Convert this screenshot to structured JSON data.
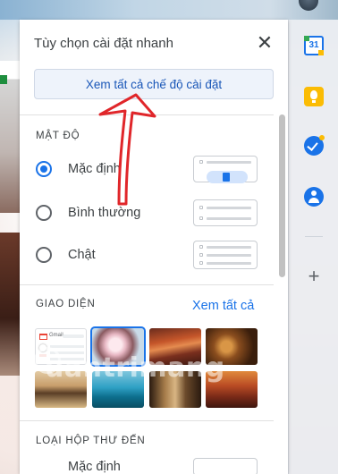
{
  "quick_settings": {
    "title": "Tùy chọn cài đặt nhanh",
    "see_all_settings_label": "Xem tất cả chế độ cài đặt",
    "density": {
      "section_label": "MẬT ĐỘ",
      "options": [
        {
          "label": "Mặc định",
          "selected": true
        },
        {
          "label": "Bình thường",
          "selected": false
        },
        {
          "label": "Chật",
          "selected": false
        }
      ]
    },
    "theme": {
      "section_label": "GIAO DIỆN",
      "see_all_label": "Xem tất cả",
      "tiles": [
        {
          "name": "theme-default"
        },
        {
          "name": "theme-cherry-blossom",
          "selected": true
        },
        {
          "name": "theme-canyon"
        },
        {
          "name": "theme-autumn-leaves"
        },
        {
          "name": "theme-beach-rock"
        },
        {
          "name": "theme-lake"
        },
        {
          "name": "theme-chess"
        },
        {
          "name": "theme-sunset-rock"
        }
      ],
      "default_tile_text": "Gmail"
    },
    "inbox_type": {
      "section_label": "LOẠI HỘP THƯ ĐẾN",
      "first_option": "Mặc định"
    }
  },
  "side_panel": {
    "calendar_day": "31",
    "icons": [
      "calendar-icon",
      "keep-icon",
      "tasks-icon",
      "contacts-icon",
      "add-icon"
    ]
  },
  "watermark": "uantrimang",
  "colors": {
    "accent": "#1a73e8",
    "annotation_arrow": "#e0262a"
  }
}
